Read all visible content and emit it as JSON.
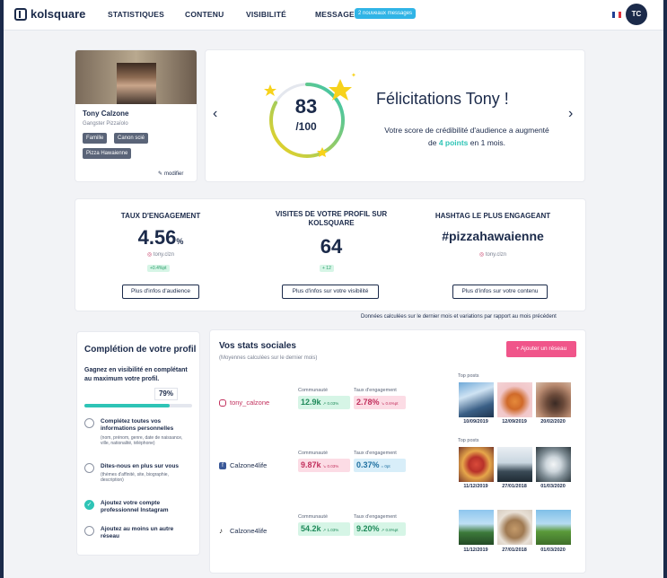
{
  "header": {
    "logo_text": "kolsquare",
    "nav": [
      "STATISTIQUES",
      "CONTENU",
      "VISIBILITÉ",
      "MESSAGES"
    ],
    "messages_badge": "2 nouveaux messages",
    "user_initials": "TC",
    "flag_colors": [
      "#1f3f93",
      "#ffffff",
      "#e0323c"
    ]
  },
  "profile": {
    "name": "Tony Calzone",
    "subtitle": "Gangster Pizzaïolo",
    "tags": [
      "Famille",
      "Canon scié",
      "Pizza Hawaienne"
    ],
    "edit_label": "modifier"
  },
  "score": {
    "value": "83",
    "max": "/100",
    "fraction": 0.83,
    "headline": "Félicitations Tony !",
    "message_before": "Votre score de crédibilité d'audience a augmenté de ",
    "message_highlight": "4 points",
    "message_after": " en 1 mois.",
    "colors": {
      "arc_start": "#f7d21b",
      "arc_end": "#2ec4b6",
      "star": "#f7d21b"
    }
  },
  "stats": {
    "engagement": {
      "title": "TAUX D'ENGAGEMENT",
      "value": "4.56",
      "unit": "%",
      "account": "tony.clzn",
      "pill": "+0.4%pt",
      "button": "Plus d'infos d'audience"
    },
    "visits": {
      "title": "VISITES DE VOTRE PROFIL SUR KOLSQUARE",
      "value": "64",
      "pill": "+ 12",
      "button": "Plus d'infos sur votre visibilité"
    },
    "hashtag": {
      "title": "HASHTAG LE PLUS ENGAGEANT",
      "value": "#pizzahawaienne",
      "account": "tony.clzn",
      "button": "Plus d'infos sur votre contenu"
    },
    "footnote": "Données calculées sur le dernier mois et variations par rapport au mois précédent"
  },
  "completion": {
    "title": "Complétion de votre profil",
    "intro": "Gagnez en visibilité en complétant au maximum votre profil.",
    "percent_label": "79%",
    "percent": 0.79,
    "items": [
      {
        "label": "Complétez toutes vos informations personnelles",
        "sub": "(nom, prénom, genre, date de naissance, ville, nationalité, téléphone)",
        "done": false
      },
      {
        "label": "Dites-nous en plus sur vous",
        "sub": "(thèmes d'affinité, site, biographie, description)",
        "done": false
      },
      {
        "label": "Ajoutez votre compte professionnel Instagram",
        "sub": "",
        "done": true
      },
      {
        "label": "Ajoutez au moins un autre réseau",
        "sub": "",
        "done": false
      }
    ]
  },
  "social": {
    "title": "Vos stats sociales",
    "subtitle": "(Moyennes calculées sur le dernier mois)",
    "add_button": "+  Ajouter un réseau",
    "community_label": "Communauté",
    "engagement_label": "Taux d'engagement",
    "top_posts_label": "Top posts",
    "accounts": [
      {
        "network": "instagram",
        "name": "tony_calzone",
        "name_color": "#c2305d",
        "icon_color": "#c2305d",
        "community": "12.9k",
        "community_delta": "↗ 0.03%",
        "community_tone": "green",
        "engagement": "2.78%",
        "engagement_delta": "↘ 0.6%pt",
        "engagement_tone": "red",
        "dates": [
          "10/09/2019",
          "12/09/2019",
          "20/02/2020"
        ]
      },
      {
        "network": "facebook",
        "name": "Calzone4life",
        "name_color": "#1b2a4a",
        "icon_color": "#3b5998",
        "community": "9.87k",
        "community_delta": "↘ 0.03%",
        "community_tone": "red",
        "engagement": "0.37%",
        "engagement_delta": "=  0pt",
        "engagement_tone": "blue",
        "dates": [
          "11/12/2019",
          "27/01/2018",
          "01/03/2020"
        ]
      },
      {
        "network": "tiktok",
        "name": "Calzone4life",
        "name_color": "#1b2a4a",
        "icon_color": "#111111",
        "community": "54.2k",
        "community_delta": "↗ 1.03%",
        "community_tone": "green",
        "engagement": "9.20%",
        "engagement_delta": "↗ 0.8%pt",
        "engagement_tone": "green",
        "dates": [
          "11/12/2019",
          "27/01/2018",
          "01/03/2020"
        ]
      }
    ]
  }
}
